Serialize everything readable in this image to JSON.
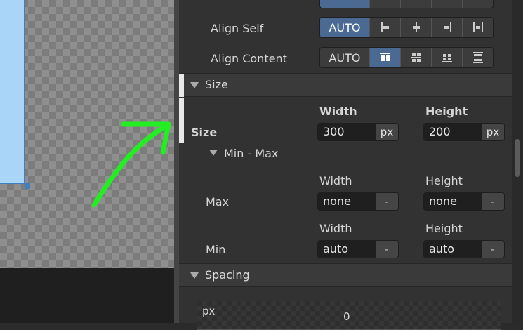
{
  "canvas": {
    "annotation_color": "#22ee22",
    "selection_color": "#3d7fc1"
  },
  "layout": {
    "align_self": {
      "label": "Align Self",
      "auto_label": "AUTO",
      "selected": "AUTO",
      "icons": [
        "align-start-icon",
        "align-center-icon",
        "align-end-icon",
        "align-stretch-icon"
      ]
    },
    "align_content": {
      "label": "Align Content",
      "auto_label": "AUTO",
      "selected": "content-start",
      "icons": [
        "content-start-icon",
        "content-center-icon",
        "content-end-icon",
        "content-space-between-icon"
      ]
    }
  },
  "size_section": {
    "title": "Size",
    "row_label": "Size",
    "width_header": "Width",
    "height_header": "Height",
    "width": {
      "value": "300",
      "unit": "px"
    },
    "height": {
      "value": "200",
      "unit": "px"
    },
    "minmax": {
      "title": "Min - Max",
      "max": {
        "label": "Max",
        "width_header": "Width",
        "height_header": "Height",
        "width": {
          "value": "none",
          "unit": "-"
        },
        "height": {
          "value": "none",
          "unit": "-"
        }
      },
      "min": {
        "label": "Min",
        "width_header": "Width",
        "height_header": "Height",
        "width": {
          "value": "auto",
          "unit": "-"
        },
        "height": {
          "value": "auto",
          "unit": "-"
        }
      }
    }
  },
  "spacing_section": {
    "title": "Spacing",
    "unit_label": "px",
    "margin_top": "0"
  }
}
